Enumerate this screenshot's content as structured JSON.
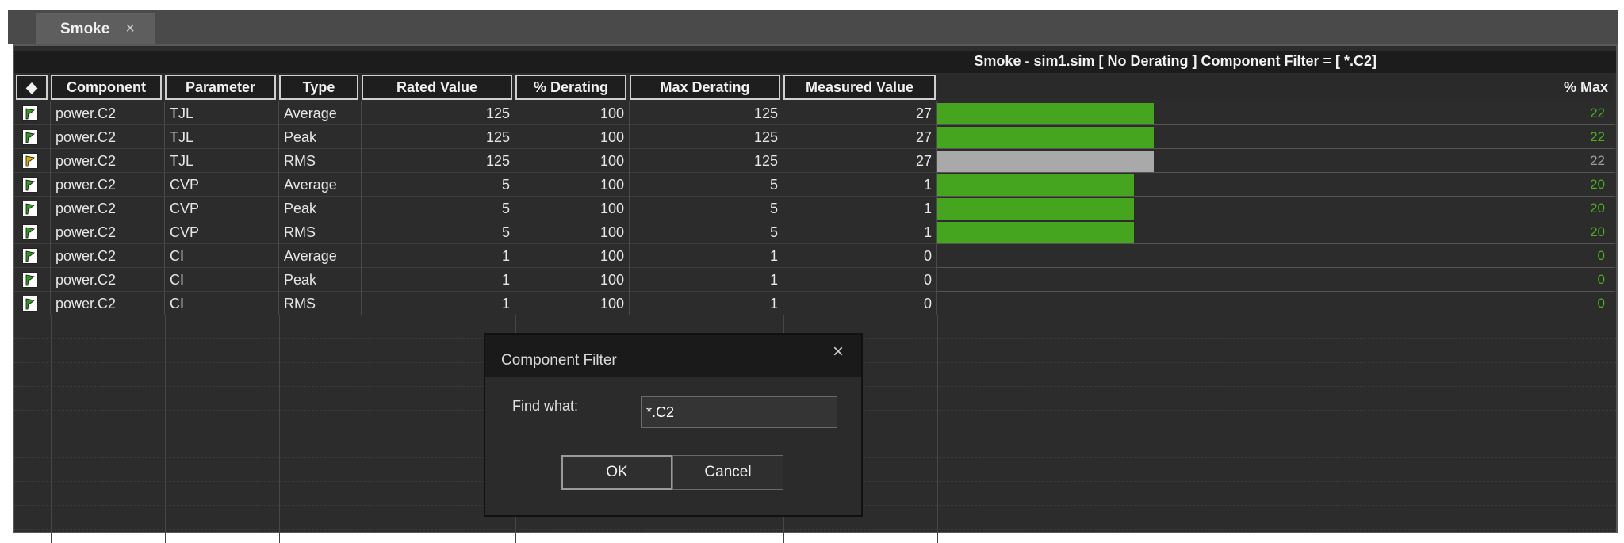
{
  "tab": {
    "label": "Smoke",
    "close": "×"
  },
  "window": {
    "title": "Smoke - sim1.sim  [ No Derating ] Component Filter = [ *.C2]"
  },
  "colors": {
    "green": "#45a51f",
    "gray": "#a9a9a9",
    "green_text": "#4caf1e",
    "gray_text": "#a0a0a0"
  },
  "columns": {
    "flag": "◆",
    "component": "Component",
    "parameter": "Parameter",
    "type": "Type",
    "rated": "Rated Value",
    "derating": "% Derating",
    "max_derating": "Max Derating",
    "measured": "Measured Value",
    "pct_max": "% Max"
  },
  "rows": [
    {
      "flag": "green",
      "component": "power.C2",
      "parameter": "TJL",
      "type": "Average",
      "rated": "125",
      "derating": "100",
      "max_derating": "125",
      "measured": "27",
      "pct": "22",
      "fill": 0.32,
      "status": "ok"
    },
    {
      "flag": "green",
      "component": "power.C2",
      "parameter": "TJL",
      "type": "Peak",
      "rated": "125",
      "derating": "100",
      "max_derating": "125",
      "measured": "27",
      "pct": "22",
      "fill": 0.32,
      "status": "ok"
    },
    {
      "flag": "yellow",
      "component": "power.C2",
      "parameter": "TJL",
      "type": "RMS",
      "rated": "125",
      "derating": "100",
      "max_derating": "125",
      "measured": "27",
      "pct": "22",
      "fill": 0.32,
      "status": "neutral"
    },
    {
      "flag": "green",
      "component": "power.C2",
      "parameter": "CVP",
      "type": "Average",
      "rated": "5",
      "derating": "100",
      "max_derating": "5",
      "measured": "1",
      "pct": "20",
      "fill": 0.29,
      "status": "ok"
    },
    {
      "flag": "green",
      "component": "power.C2",
      "parameter": "CVP",
      "type": "Peak",
      "rated": "5",
      "derating": "100",
      "max_derating": "5",
      "measured": "1",
      "pct": "20",
      "fill": 0.29,
      "status": "ok"
    },
    {
      "flag": "green",
      "component": "power.C2",
      "parameter": "CVP",
      "type": "RMS",
      "rated": "5",
      "derating": "100",
      "max_derating": "5",
      "measured": "1",
      "pct": "20",
      "fill": 0.29,
      "status": "ok"
    },
    {
      "flag": "green",
      "component": "power.C2",
      "parameter": "CI",
      "type": "Average",
      "rated": "1",
      "derating": "100",
      "max_derating": "1",
      "measured": "0",
      "pct": "0",
      "fill": 0,
      "status": "ok"
    },
    {
      "flag": "green",
      "component": "power.C2",
      "parameter": "CI",
      "type": "Peak",
      "rated": "1",
      "derating": "100",
      "max_derating": "1",
      "measured": "0",
      "pct": "0",
      "fill": 0,
      "status": "ok"
    },
    {
      "flag": "green",
      "component": "power.C2",
      "parameter": "CI",
      "type": "RMS",
      "rated": "1",
      "derating": "100",
      "max_derating": "1",
      "measured": "0",
      "pct": "0",
      "fill": 0,
      "status": "ok"
    }
  ],
  "dialog": {
    "title": "Component Filter",
    "close": "×",
    "find_label": "Find what:",
    "find_value": "*.C2",
    "ok": "OK",
    "cancel": "Cancel"
  }
}
